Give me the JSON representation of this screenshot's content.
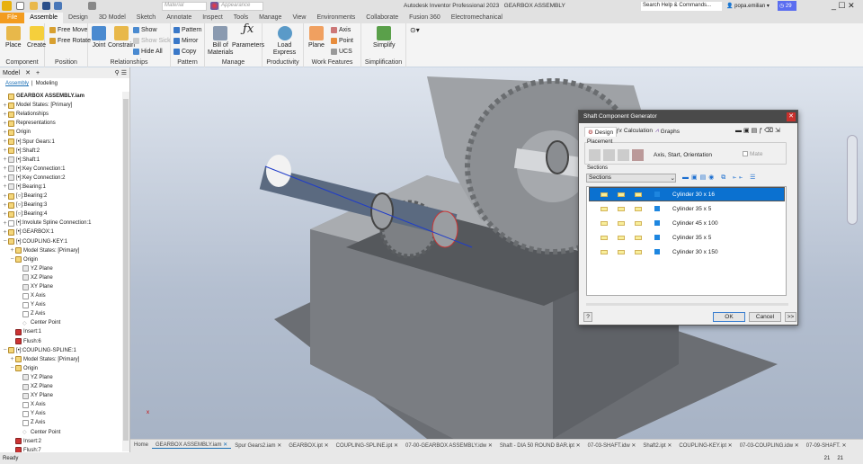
{
  "title": {
    "app": "Autodesk Inventor Professional 2023",
    "doc": "GEARBOX ASSEMBLY",
    "material": "Material",
    "appearance": "Appearance",
    "search": "Search Help & Commands...",
    "user": "popa.emilian",
    "timer": "29"
  },
  "tabs": [
    "File",
    "Assemble",
    "Design",
    "3D Model",
    "Sketch",
    "Annotate",
    "Inspect",
    "Tools",
    "Manage",
    "View",
    "Environments",
    "Collaborate",
    "Fusion 360",
    "Electromechanical"
  ],
  "ribbon": {
    "component": {
      "label": "Component",
      "place": "Place",
      "create": "Create"
    },
    "position": {
      "label": "Position",
      "free_move": "Free Move",
      "free_rotate": "Free Rotate"
    },
    "relationships": {
      "label": "Relationships",
      "joint": "Joint",
      "constrain": "Constrain",
      "show": "Show",
      "show_sick": "Show Sick",
      "hide_all": "Hide All"
    },
    "pattern": {
      "label": "Pattern",
      "pattern": "Pattern",
      "mirror": "Mirror",
      "copy": "Copy"
    },
    "manage": {
      "label": "Manage",
      "bom1": "Bill of",
      "bom2": "Materials",
      "parameters": "Parameters"
    },
    "productivity": {
      "label": "Productivity",
      "load_express": "Load Express"
    },
    "work_features": {
      "label": "Work Features",
      "plane": "Plane",
      "axis": "Axis",
      "point": "Point",
      "ucs": "UCS"
    },
    "simplification": {
      "label": "Simplification",
      "simplify": "Simplify"
    }
  },
  "browser": {
    "tab": "Model",
    "sub_assembly": "Assembly",
    "sub_modeling": "Modeling",
    "items": [
      {
        "t": "GEARBOX ASSEMBLY.iam",
        "l": 0,
        "e": "",
        "i": "asm"
      },
      {
        "t": "Model States: [Primary]",
        "l": 0,
        "e": "+",
        "i": "folder"
      },
      {
        "t": "Relationships",
        "l": 0,
        "e": "+",
        "i": "folder"
      },
      {
        "t": "Representations",
        "l": 0,
        "e": "+",
        "i": "folder"
      },
      {
        "t": "Origin",
        "l": 0,
        "e": "+",
        "i": "folder"
      },
      {
        "t": "[•]:Spur Gears:1",
        "l": 0,
        "e": "+",
        "i": "part"
      },
      {
        "t": "[•]:Shaft:2",
        "l": 0,
        "e": "+",
        "i": "part"
      },
      {
        "t": "[•]:Shaft:1",
        "l": 0,
        "e": "+",
        "i": "plane"
      },
      {
        "t": "[•]:Key Connection:1",
        "l": 0,
        "e": "+",
        "i": "plane"
      },
      {
        "t": "[•]:Key Connection:2",
        "l": 0,
        "e": "+",
        "i": "plane"
      },
      {
        "t": "[•]:Bearing:1",
        "l": 0,
        "e": "+",
        "i": "plane"
      },
      {
        "t": "[○]:Bearing:2",
        "l": 0,
        "e": "+",
        "i": "part"
      },
      {
        "t": "[○]:Bearing:3",
        "l": 0,
        "e": "+",
        "i": "part"
      },
      {
        "t": "[○]:Bearing:4",
        "l": 0,
        "e": "+",
        "i": "part"
      },
      {
        "t": "[•]:Involute Spline Connection:1",
        "l": 0,
        "e": "+",
        "i": "axis"
      },
      {
        "t": "[•]:GEARBOX:1",
        "l": 0,
        "e": "+",
        "i": "part"
      },
      {
        "t": "[•]:COUPLING-KEY:1",
        "l": 0,
        "e": "−",
        "i": "part"
      },
      {
        "t": "Model States: [Primary]",
        "l": 1,
        "e": "+",
        "i": "folder"
      },
      {
        "t": "Origin",
        "l": 1,
        "e": "−",
        "i": "folder"
      },
      {
        "t": "YZ Plane",
        "l": 2,
        "e": "",
        "i": "plane"
      },
      {
        "t": "XZ Plane",
        "l": 2,
        "e": "",
        "i": "plane"
      },
      {
        "t": "XY Plane",
        "l": 2,
        "e": "",
        "i": "plane"
      },
      {
        "t": "X Axis",
        "l": 2,
        "e": "",
        "i": "axis"
      },
      {
        "t": "Y Axis",
        "l": 2,
        "e": "",
        "i": "axis"
      },
      {
        "t": "Z Axis",
        "l": 2,
        "e": "",
        "i": "axis"
      },
      {
        "t": "Center Point",
        "l": 2,
        "e": "",
        "i": "pt"
      },
      {
        "t": "Insert:1",
        "l": 1,
        "e": "",
        "i": "red"
      },
      {
        "t": "Flush:6",
        "l": 1,
        "e": "",
        "i": "red"
      },
      {
        "t": "[•]:COUPLING-SPLINE:1",
        "l": 0,
        "e": "−",
        "i": "part"
      },
      {
        "t": "Model States: [Primary]",
        "l": 1,
        "e": "+",
        "i": "folder"
      },
      {
        "t": "Origin",
        "l": 1,
        "e": "−",
        "i": "folder"
      },
      {
        "t": "YZ Plane",
        "l": 2,
        "e": "",
        "i": "plane"
      },
      {
        "t": "XZ Plane",
        "l": 2,
        "e": "",
        "i": "plane"
      },
      {
        "t": "XY Plane",
        "l": 2,
        "e": "",
        "i": "plane"
      },
      {
        "t": "X Axis",
        "l": 2,
        "e": "",
        "i": "axis"
      },
      {
        "t": "Y Axis",
        "l": 2,
        "e": "",
        "i": "axis"
      },
      {
        "t": "Z Axis",
        "l": 2,
        "e": "",
        "i": "axis"
      },
      {
        "t": "Center Point",
        "l": 2,
        "e": "",
        "i": "pt"
      },
      {
        "t": "Insert:2",
        "l": 1,
        "e": "",
        "i": "red"
      },
      {
        "t": "Flush:7",
        "l": 1,
        "e": "",
        "i": "red"
      }
    ]
  },
  "dialog": {
    "title": "Shaft Component Generator",
    "tabs": [
      "Design",
      "Calculation",
      "Graphs"
    ],
    "placement": "Placement",
    "placement_text": "Axis, Start, Orientation",
    "mate": "Mate",
    "sections_label": "Sections",
    "sections_select": "Sections",
    "sections": [
      "Cylinder 30 x 16",
      "Cylinder 35 x 5",
      "Cylinder 45 x 100",
      "Cylinder 35 x 5",
      "Cylinder 30 x 150"
    ],
    "ok": "OK",
    "cancel": "Cancel",
    "more": ">>",
    "help": "?"
  },
  "doc_tabs": [
    "Home",
    "GEARBOX ASSEMBLY.iam",
    "Spur Gears2.iam",
    "GEARBOX.ipt",
    "COUPLING-SPLINE.ipt",
    "07-00-GEARBOX ASSEMBLY.idw",
    "Shaft - DIA 50 ROUND BAR.ipt",
    "07-03-SHAFT.idw",
    "Shaft2.ipt",
    "COUPLING-KEY.ipt",
    "07-03-COUPLING.idw",
    "07-09-SHAFT."
  ],
  "status": {
    "text": "Ready",
    "n1": "21",
    "n2": "21"
  }
}
